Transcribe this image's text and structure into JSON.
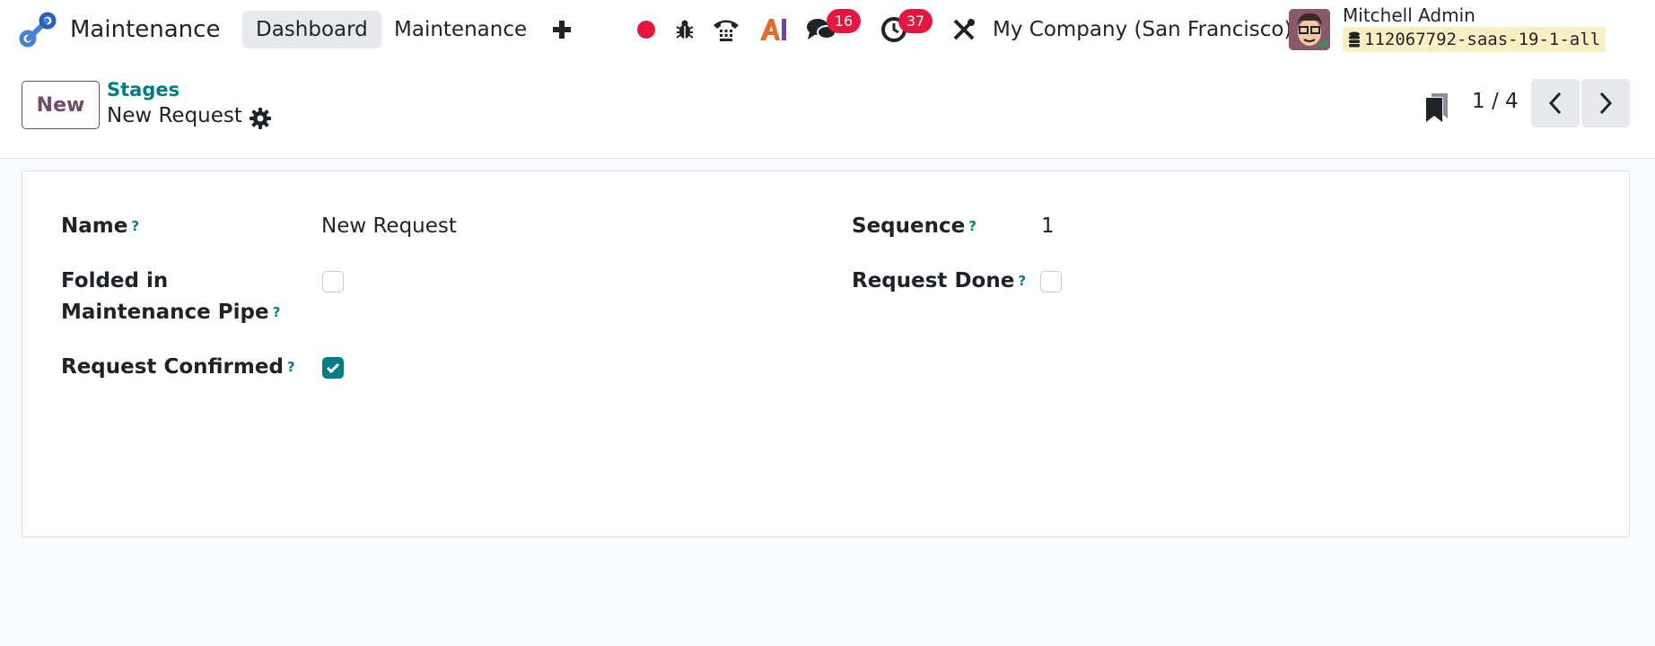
{
  "navbar": {
    "app_name": "Maintenance",
    "menus": [
      {
        "label": "Dashboard",
        "active": true
      },
      {
        "label": "Maintenance",
        "active": false
      }
    ],
    "new_menu_icon": "plus-icon",
    "systray": {
      "record_icon": "record-dot-icon",
      "debug_icon": "bug-icon",
      "phone_icon": "phone-icon",
      "ai_icon": "ai-icon",
      "messages_icon": "chat-bubbles-icon",
      "messages_count": "16",
      "activities_icon": "clock-icon",
      "activities_count": "37",
      "tools_icon": "tools-icon"
    },
    "company": "My Company (San Francisco)",
    "user_name": "Mitchell Admin",
    "database": "112067792-saas-19-1-all",
    "brand_color": "#714b67",
    "accent_color": "#017e84",
    "badge_color": "#e5173f"
  },
  "control_panel": {
    "new_button": "New",
    "breadcrumb_parent": "Stages",
    "breadcrumb_current": "New Request",
    "pager": "1 / 4"
  },
  "form": {
    "name_label": "Name",
    "name_value": "New Request",
    "folded_label": "Folded in Maintenance Pipe",
    "folded_checked": false,
    "confirmed_label": "Request Confirmed",
    "confirmed_checked": true,
    "sequence_label": "Sequence",
    "sequence_value": "1",
    "done_label": "Request Done",
    "done_checked": false,
    "help_mark": "?"
  }
}
